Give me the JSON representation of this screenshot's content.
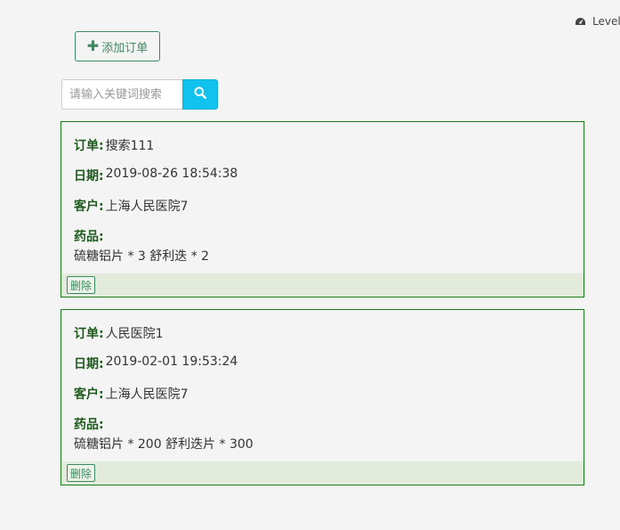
{
  "header": {
    "level_label": "Level",
    "level_icon": "dashboard-icon"
  },
  "toolbar": {
    "add_order_label": "添加订单"
  },
  "search": {
    "placeholder": "请输入关键词搜索",
    "value": ""
  },
  "orders": [
    {
      "order_label": "订单:",
      "order_value": "搜索111",
      "date_label": "日期:",
      "date_value": "2019-08-26 18:54:38",
      "customer_label": "客户:",
      "customer_value": "上海人民医院7",
      "drugs_label": "药品:",
      "drugs_value": "硫糖铝片 * 3 舒利迭 * 2",
      "delete_label": "删除"
    },
    {
      "order_label": "订单:",
      "order_value": "人民医院1",
      "date_label": "日期:",
      "date_value": "2019-02-01 19:53:24",
      "customer_label": "客户:",
      "customer_value": "上海人民医院7",
      "drugs_label": "药品:",
      "drugs_value": "硫糖铝片 * 200 舒利迭片 * 300",
      "delete_label": "删除"
    }
  ],
  "colors": {
    "accent": "#3c8a60",
    "search_button": "#11c2ee",
    "card_border": "#1a7a1a",
    "card_footer": "#e3ecdc"
  }
}
